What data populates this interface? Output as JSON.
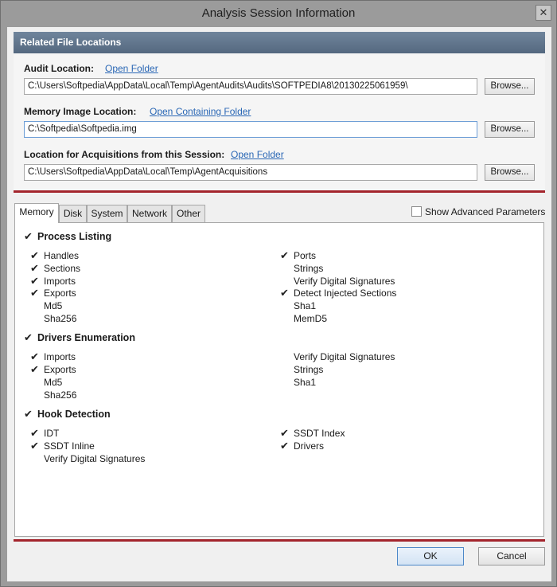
{
  "window": {
    "title": "Analysis Session Information",
    "close_glyph": "✕"
  },
  "locations": {
    "header": "Related File Locations",
    "audit": {
      "label": "Audit Location:",
      "link": "Open Folder",
      "path": "C:\\Users\\Softpedia\\AppData\\Local\\Temp\\AgentAudits\\Audits\\SOFTPEDIA8\\20130225061959\\",
      "browse": "Browse..."
    },
    "memory": {
      "label": "Memory Image Location:",
      "link": "Open Containing Folder",
      "path": "C:\\Softpedia\\Softpedia.img",
      "browse": "Browse..."
    },
    "acquisitions": {
      "label": "Location for Acquisitions from this Session:",
      "link": "Open Folder",
      "path": "C:\\Users\\Softpedia\\AppData\\Local\\Temp\\AgentAcquisitions",
      "browse": "Browse..."
    }
  },
  "tabs": [
    {
      "label": "Memory",
      "active": true
    },
    {
      "label": "Disk"
    },
    {
      "label": "System"
    },
    {
      "label": "Network"
    },
    {
      "label": "Other"
    }
  ],
  "show_advanced": {
    "label": "Show Advanced Parameters",
    "checked": false
  },
  "check_glyph": "✔",
  "groups": {
    "process": {
      "title": "Process Listing",
      "checked": true,
      "left": [
        {
          "label": "Handles",
          "checked": true
        },
        {
          "label": "Sections",
          "checked": true
        },
        {
          "label": "Imports",
          "checked": true
        },
        {
          "label": "Exports",
          "checked": true
        },
        {
          "label": "Md5",
          "checked": false
        },
        {
          "label": "Sha256",
          "checked": false
        }
      ],
      "right": [
        {
          "label": "Ports",
          "checked": true
        },
        {
          "label": "Strings",
          "checked": false
        },
        {
          "label": "Verify Digital Signatures",
          "checked": false
        },
        {
          "label": "Detect Injected Sections",
          "checked": true
        },
        {
          "label": "Sha1",
          "checked": false
        },
        {
          "label": "MemD5",
          "checked": false
        }
      ]
    },
    "drivers": {
      "title": "Drivers Enumeration",
      "checked": true,
      "left": [
        {
          "label": "Imports",
          "checked": true
        },
        {
          "label": "Exports",
          "checked": true
        },
        {
          "label": "Md5",
          "checked": false
        },
        {
          "label": "Sha256",
          "checked": false
        }
      ],
      "right": [
        {
          "label": "Verify Digital Signatures",
          "checked": false
        },
        {
          "label": "Strings",
          "checked": false
        },
        {
          "label": "Sha1",
          "checked": false
        }
      ]
    },
    "hook": {
      "title": "Hook Detection",
      "checked": true,
      "left": [
        {
          "label": "IDT",
          "checked": true
        },
        {
          "label": "SSDT Inline",
          "checked": true
        },
        {
          "label": "Verify Digital Signatures",
          "checked": false
        }
      ],
      "right": [
        {
          "label": "SSDT Index",
          "checked": true
        },
        {
          "label": "Drivers",
          "checked": true
        }
      ]
    }
  },
  "buttons": {
    "ok": "OK",
    "cancel": "Cancel"
  }
}
